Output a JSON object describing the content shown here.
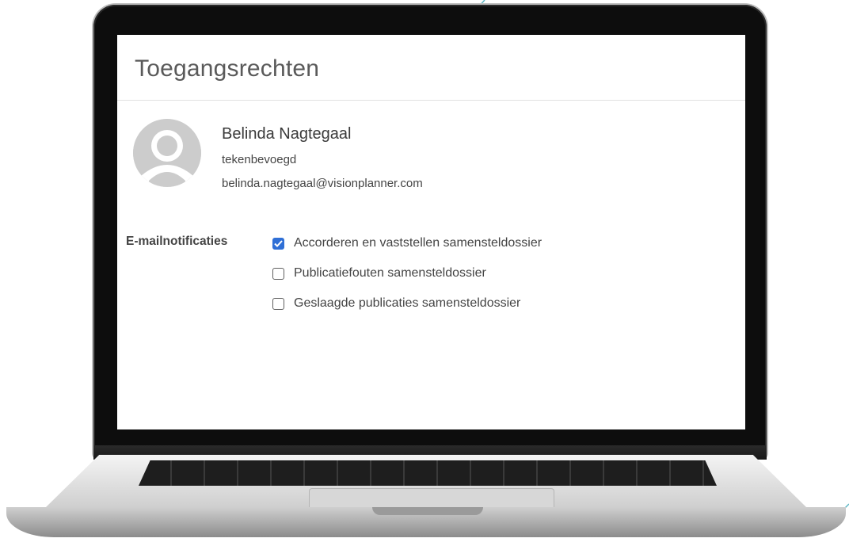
{
  "page": {
    "title": "Toegangsrechten"
  },
  "user": {
    "name": "Belinda Nagtegaal",
    "role": "tekenbevoegd",
    "email": "belinda.nagtegaal@visionplanner.com",
    "avatar_icon": "person-avatar-icon"
  },
  "notifications": {
    "label": "E-mailnotificaties",
    "items": [
      {
        "label": "Accorderen en vaststellen samensteldossier",
        "checked": true
      },
      {
        "label": "Publicatiefouten samensteldossier",
        "checked": false
      },
      {
        "label": "Geslaagde publicaties samensteldossier",
        "checked": false
      }
    ]
  },
  "colors": {
    "checkbox_checked": "#2f6fd6",
    "accent_line": "#5db7c5",
    "laptop_frame": "#0d0d0d"
  }
}
